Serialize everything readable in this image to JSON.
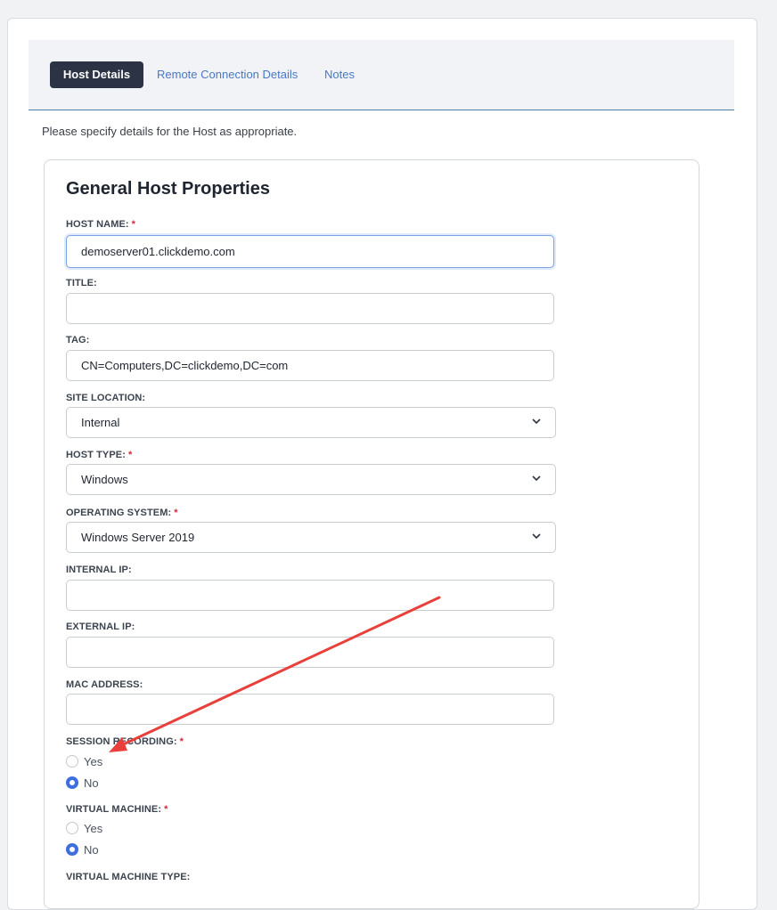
{
  "tabs": {
    "active": "Host Details",
    "remote": "Remote Connection Details",
    "notes": "Notes"
  },
  "intro": "Please specify details for the Host as appropriate.",
  "card_title": "General Host Properties",
  "required_mark": "*",
  "fields": {
    "host_name": {
      "label": "HOST NAME:",
      "value": "demoserver01.clickdemo.com"
    },
    "title": {
      "label": "TITLE:",
      "value": ""
    },
    "tag": {
      "label": "TAG:",
      "value": "CN=Computers,DC=clickdemo,DC=com"
    },
    "site_location": {
      "label": "SITE LOCATION:",
      "value": "Internal"
    },
    "host_type": {
      "label": "HOST TYPE:",
      "value": "Windows"
    },
    "operating_system": {
      "label": "OPERATING SYSTEM:",
      "value": "Windows Server 2019"
    },
    "internal_ip": {
      "label": "INTERNAL IP:",
      "value": ""
    },
    "external_ip": {
      "label": "EXTERNAL IP:",
      "value": ""
    },
    "mac_address": {
      "label": "MAC ADDRESS:",
      "value": ""
    }
  },
  "session_recording": {
    "label": "SESSION RECORDING:",
    "yes": "Yes",
    "no": "No",
    "selected": "No"
  },
  "virtual_machine": {
    "label": "VIRTUAL MACHINE:",
    "yes": "Yes",
    "no": "No",
    "selected": "No"
  },
  "virtual_machine_type": {
    "label": "VIRTUAL MACHINE TYPE:"
  },
  "colors": {
    "accent": "#3d6ee0",
    "tab_active_bg": "#2b3345",
    "required": "#d7263d",
    "annotation_arrow": "#e8403b"
  },
  "icons": {
    "select_chevron": "chevron-down-icon",
    "annotation": "red-arrow-annotation"
  }
}
